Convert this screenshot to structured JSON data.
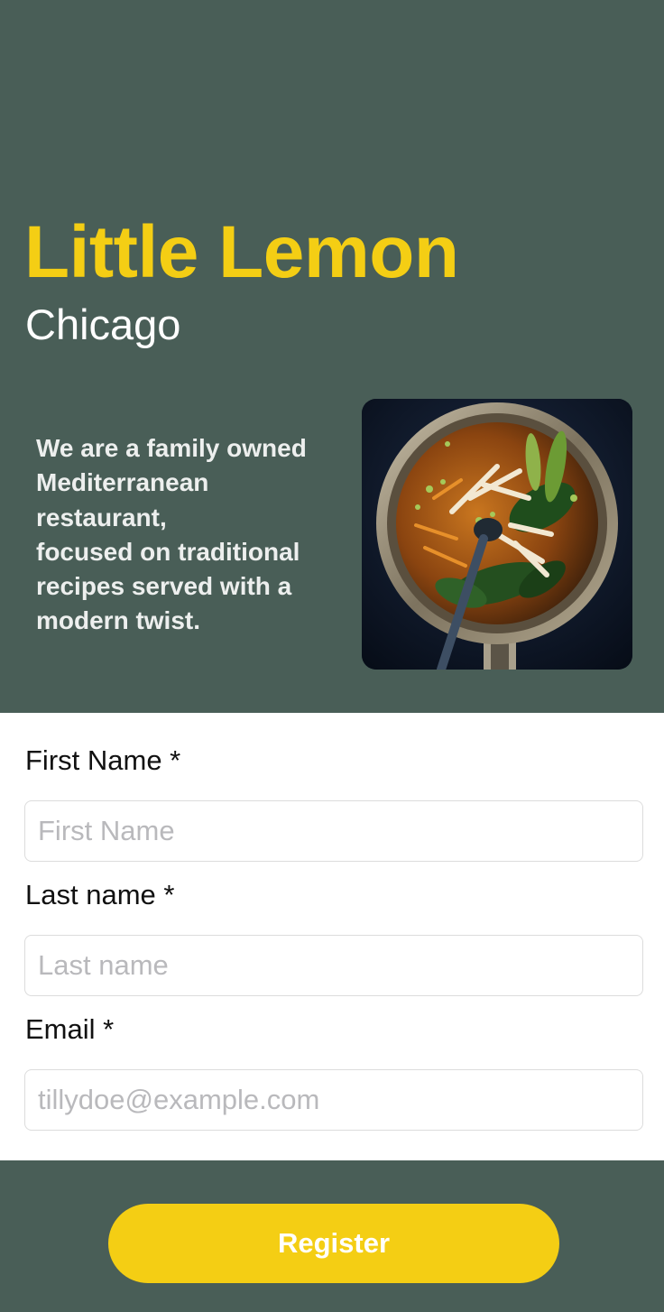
{
  "hero": {
    "title": "Little Lemon",
    "city": "Chicago",
    "description": "We are a family owned\nMediterranean\nrestaurant,\nfocused on traditional\nrecipes served with a\nmodern twist.",
    "image_icon": "food-bowl-image"
  },
  "form": {
    "first_name": {
      "label": "First Name *",
      "placeholder": "First Name",
      "value": ""
    },
    "last_name": {
      "label": "Last name *",
      "placeholder": "Last name",
      "value": ""
    },
    "email": {
      "label": "Email *",
      "placeholder": "tillydoe@example.com",
      "value": ""
    }
  },
  "footer": {
    "register_label": "Register"
  },
  "colors": {
    "primary_green": "#495e57",
    "primary_yellow": "#f4ce14",
    "background": "#ffffff"
  }
}
